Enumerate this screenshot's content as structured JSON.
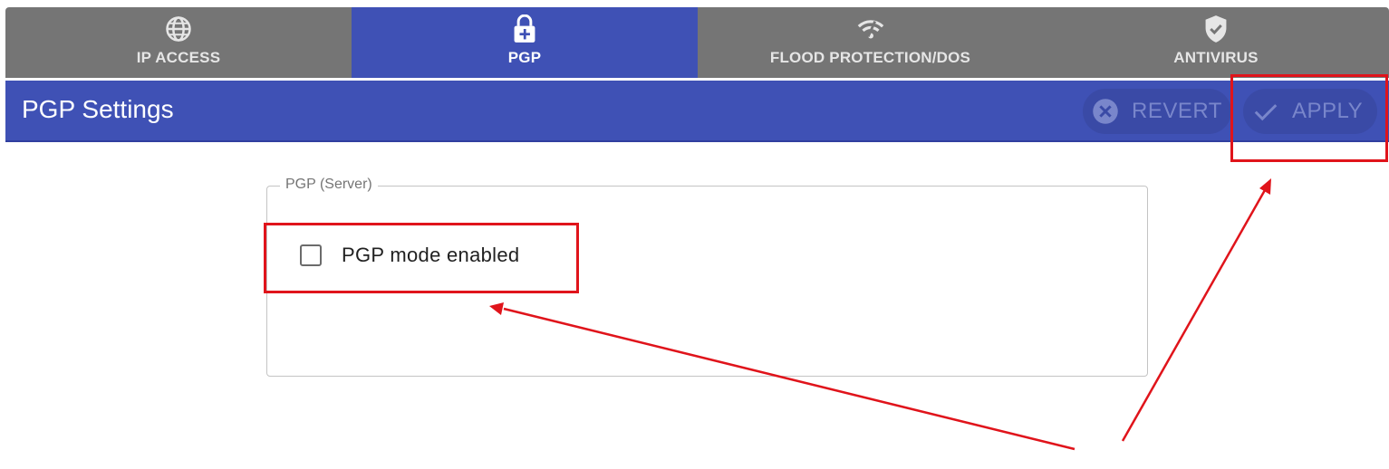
{
  "tabs": [
    {
      "label": "IP ACCESS",
      "icon": "globe-icon"
    },
    {
      "label": "PGP",
      "icon": "lock-plus-icon",
      "active": true
    },
    {
      "label": "FLOOD PROTECTION/DOS",
      "icon": "wifi-broken-icon"
    },
    {
      "label": "ANTIVIRUS",
      "icon": "shield-check-icon"
    }
  ],
  "header": {
    "title": "PGP Settings",
    "revert_label": "REVERT",
    "apply_label": "APPLY"
  },
  "section": {
    "legend": "PGP (Server)",
    "checkbox_label": "PGP mode enabled",
    "checkbox_checked": false
  },
  "colors": {
    "primary": "#3f51b5",
    "tab_inactive": "#757575",
    "annotation": "#e0141b"
  }
}
